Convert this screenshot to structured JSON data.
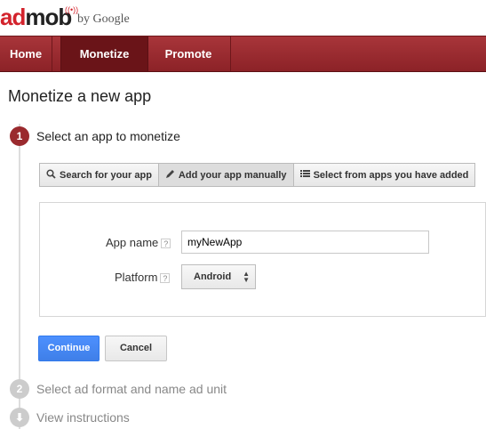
{
  "logo": {
    "brand_ad": "ad",
    "brand_mob": "mob",
    "byline": "by Google"
  },
  "nav": {
    "home": "Home",
    "monetize": "Monetize",
    "promote": "Promote"
  },
  "page": {
    "title": "Monetize a new app"
  },
  "steps": [
    {
      "number": "1",
      "label": "Select an app to monetize",
      "state": "active"
    },
    {
      "number": "2",
      "label": "Select ad format and name ad unit",
      "state": "inactive"
    },
    {
      "number": "⬇",
      "label": "View instructions",
      "state": "inactive"
    }
  ],
  "tabs": [
    {
      "label": "Search for your app",
      "icon": "search-icon"
    },
    {
      "label": "Add your app manually",
      "icon": "pencil-icon"
    },
    {
      "label": "Select from apps you have added",
      "icon": "list-icon"
    }
  ],
  "form": {
    "app_name_label": "App name",
    "app_name_value": "myNewApp",
    "platform_label": "Platform",
    "platform_value": "Android",
    "help": "?"
  },
  "buttons": {
    "continue": "Continue",
    "cancel": "Cancel"
  },
  "colors": {
    "brand_red": "#9a2a2e",
    "primary_blue": "#4d90fe"
  }
}
